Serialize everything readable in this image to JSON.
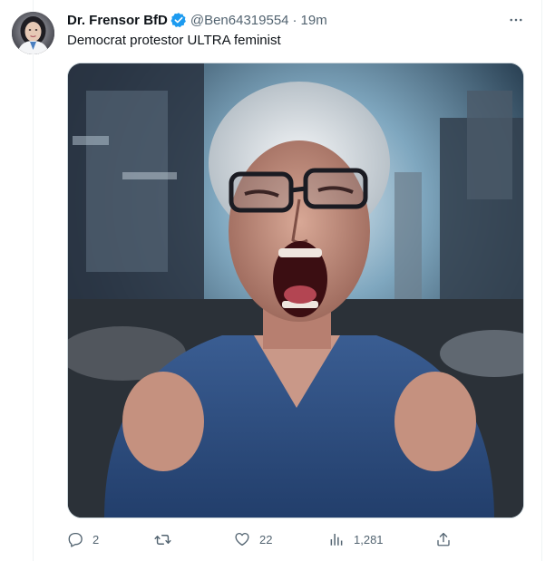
{
  "post": {
    "author_name": "Dr. Frensor BfD",
    "handle": "@Ben64319554",
    "separator": "·",
    "time": "19m",
    "text": "Democrat protestor ULTRA feminist"
  },
  "icons": {
    "verified": "verified-badge-icon",
    "more": "more-options-icon",
    "reply": "reply-icon",
    "retweet": "retweet-icon",
    "like": "like-icon",
    "views": "views-icon",
    "share": "share-icon"
  },
  "actions": {
    "reply_count": "2",
    "retweet_count": "",
    "like_count": "22",
    "views_count": "1,281"
  },
  "colors": {
    "verified": "#1d9bf0",
    "secondary_text": "#536471",
    "primary_text": "#0f1419"
  }
}
